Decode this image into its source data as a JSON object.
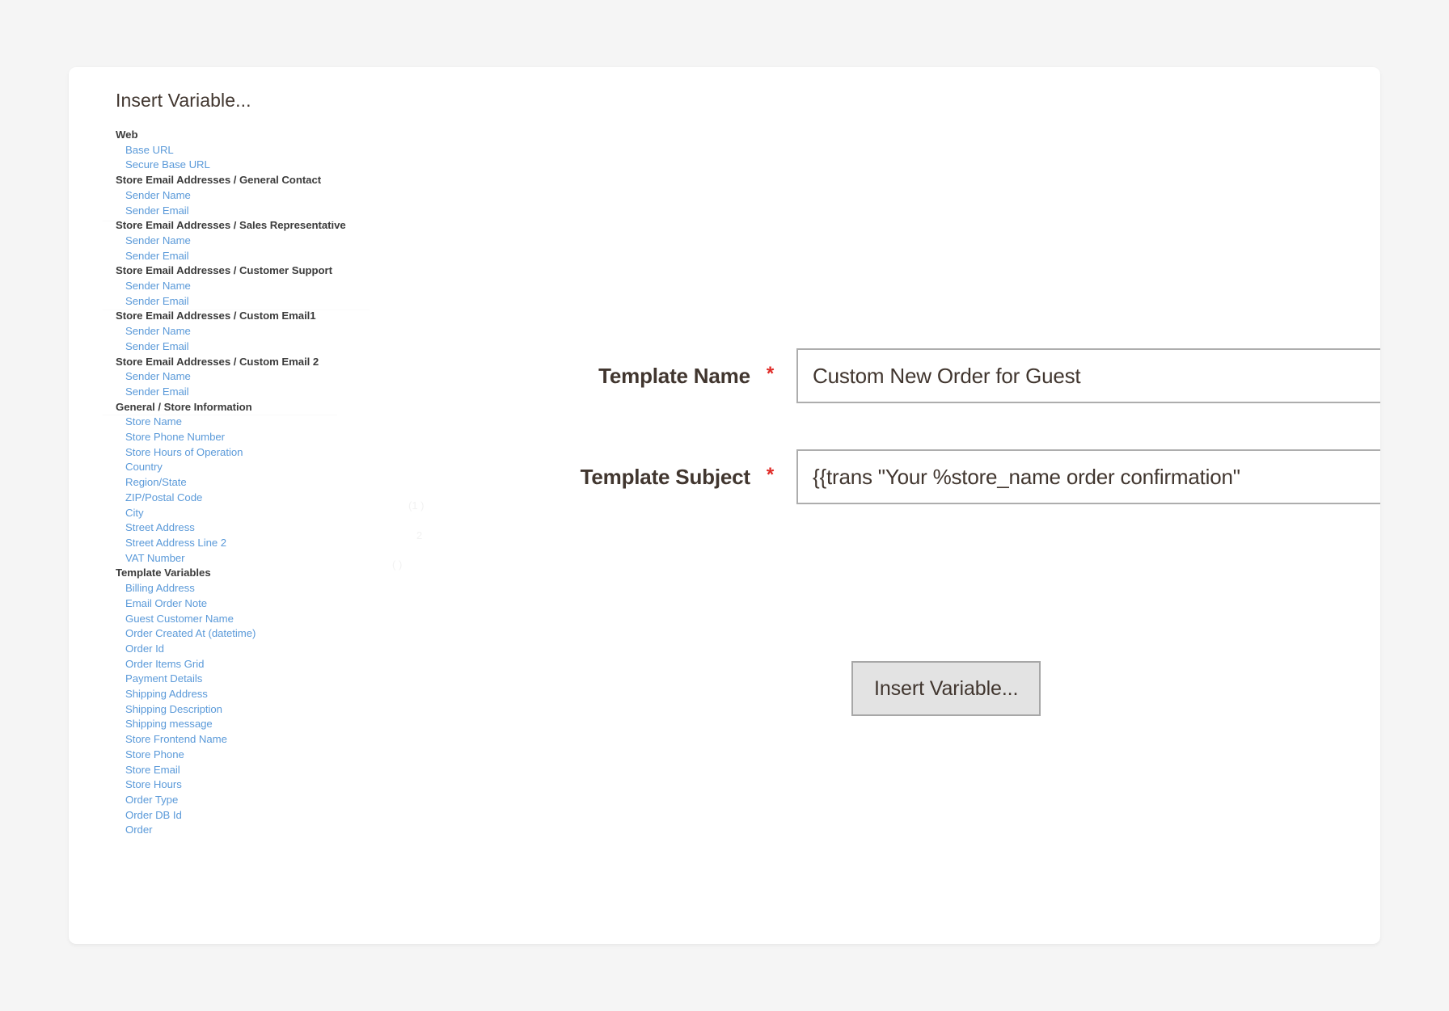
{
  "page": {
    "background_color": "#f5f5f5",
    "card_background": "#ffffff"
  },
  "colors": {
    "link": "#5b9ad9",
    "group_label": "#3c3c3c",
    "label": "#41362f",
    "required_star": "#e02b27",
    "input_border": "#adadad",
    "button_face": "#e3e3e3"
  },
  "chooser": {
    "title": "Insert Variable...",
    "groups": [
      {
        "label": "Web",
        "items": [
          "Base URL",
          "Secure Base URL"
        ]
      },
      {
        "label": "Store Email Addresses / General Contact",
        "items": [
          "Sender Name",
          "Sender Email"
        ]
      },
      {
        "label": "Store Email Addresses / Sales Representative",
        "items": [
          "Sender Name",
          "Sender Email"
        ]
      },
      {
        "label": "Store Email Addresses / Customer Support",
        "items": [
          "Sender Name",
          "Sender Email"
        ]
      },
      {
        "label": "Store Email Addresses / Custom Email1",
        "items": [
          "Sender Name",
          "Sender Email"
        ]
      },
      {
        "label": "Store Email Addresses / Custom Email 2",
        "items": [
          "Sender Name",
          "Sender Email"
        ]
      },
      {
        "label": "General / Store Information",
        "items": [
          "Store Name",
          "Store Phone Number",
          "Store Hours of Operation",
          "Country",
          "Region/State",
          "ZIP/Postal Code",
          "City",
          "Street Address",
          "Street Address Line 2",
          "VAT Number"
        ]
      },
      {
        "label": "Template Variables",
        "items": [
          "Billing Address",
          "Email Order Note",
          "Guest Customer Name",
          "Order Created At (datetime)",
          "Order Id",
          "Order Items Grid",
          "Payment Details",
          "Shipping Address",
          "Shipping Description",
          "Shipping message",
          "Store Frontend Name",
          "Store Phone",
          "Store Email",
          "Store Hours",
          "Order Type",
          "Order DB Id",
          "Order"
        ]
      }
    ]
  },
  "form": {
    "required_marker": "*",
    "fields": [
      {
        "label": "Template Name",
        "value": "Custom New Order for Guest",
        "placeholder": "Template Name",
        "required": true
      },
      {
        "label": "Template Subject",
        "value": "{{trans \"Your %store_name order confirmation\"",
        "placeholder": "Template Subject",
        "required": true
      }
    ],
    "insert_variable_button": "Insert Variable..."
  }
}
